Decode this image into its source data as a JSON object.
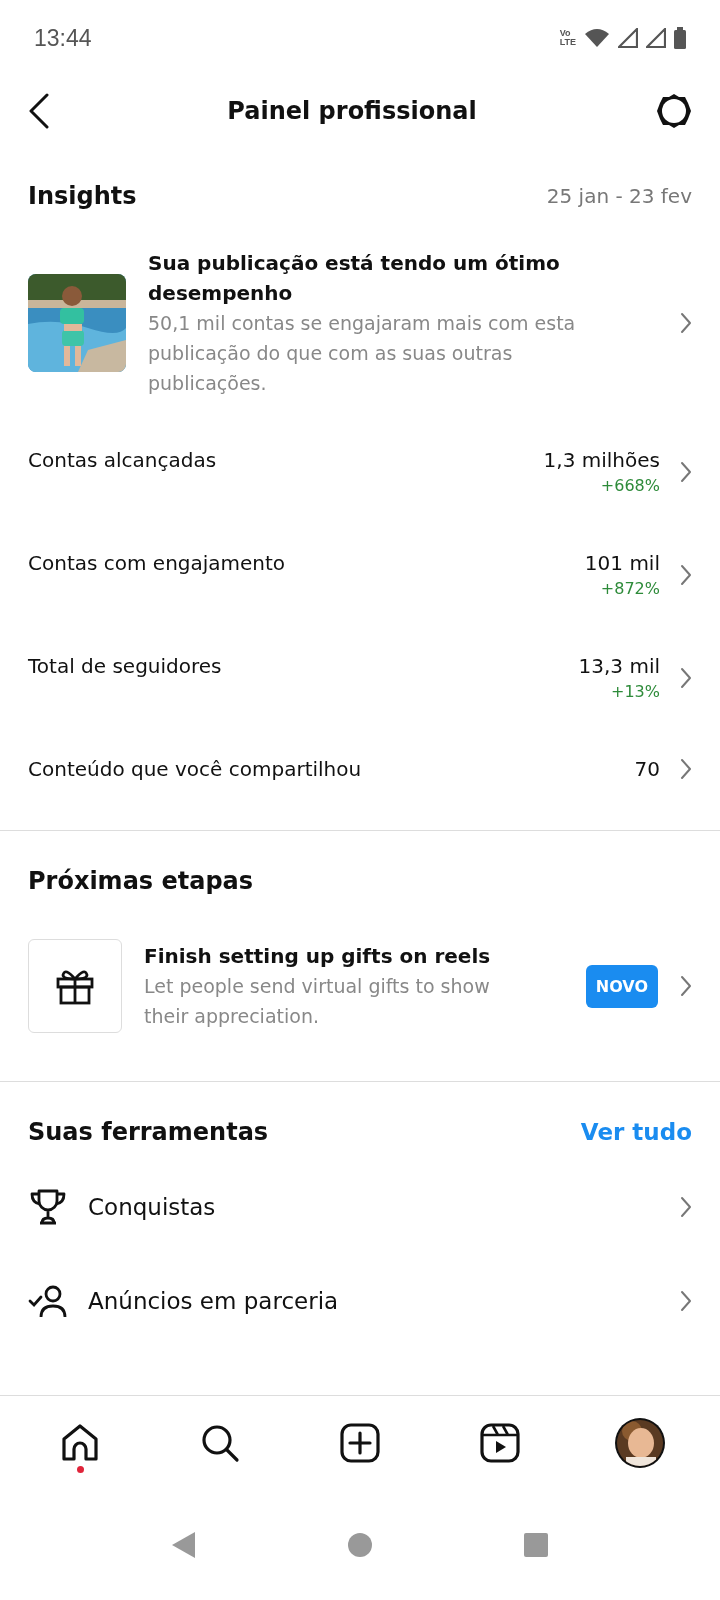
{
  "status_bar": {
    "time": "13:44",
    "network_lines": [
      "Vo",
      "LTE"
    ]
  },
  "header": {
    "title": "Painel profissional"
  },
  "insights": {
    "title": "Insights",
    "date_range": "25 jan - 23 fev",
    "highlight": {
      "kind": "picture",
      "title": "Sua publicação está tendo um ótimo desempenho",
      "description": "50,1 mil contas se engajaram mais com esta publicação do que com as suas outras publicações."
    },
    "metrics": [
      {
        "label": "Contas alcançadas",
        "value": "1,3 milhões",
        "change": "+668%"
      },
      {
        "label": "Contas com engajamento",
        "value": "101 mil",
        "change": "+872%"
      },
      {
        "label": "Total de seguidores",
        "value": "13,3 mil",
        "change": "+13%"
      },
      {
        "label": "Conteúdo que você compartilhou",
        "value": "70"
      }
    ]
  },
  "next_steps": {
    "title": "Próximas etapas",
    "items": [
      {
        "title": "Finish setting up gifts on reels",
        "description": "Let people send virtual gifts to show their appreciation.",
        "badge": "NOVO"
      }
    ]
  },
  "tools": {
    "title": "Suas ferramentas",
    "see_all": "Ver tudo",
    "items": [
      {
        "kind": "trophy",
        "label": "Conquistas"
      },
      {
        "kind": "partner",
        "label": "Anúncios em parceria"
      }
    ]
  },
  "bottom_nav": [
    {
      "kind": "home",
      "dot": true
    },
    {
      "kind": "search",
      "dot": false
    },
    {
      "kind": "create",
      "dot": false
    },
    {
      "kind": "reels",
      "dot": false
    },
    {
      "kind": "profile",
      "dot": false
    }
  ]
}
